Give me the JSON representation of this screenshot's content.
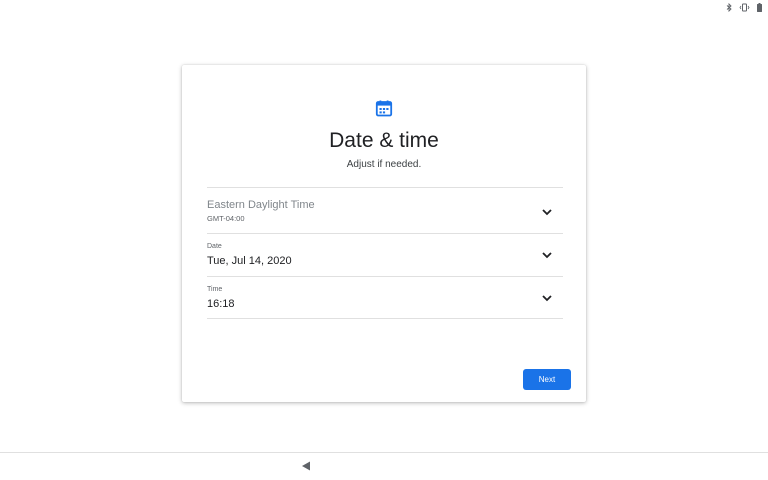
{
  "status_bar": {
    "icons": [
      "bluetooth-icon",
      "vibrate-icon",
      "battery-icon"
    ]
  },
  "card": {
    "icon": "calendar-icon",
    "title": "Date & time",
    "subtitle": "Adjust if needed."
  },
  "timezone": {
    "name": "Eastern Daylight Time",
    "offset": "GMT-04:00"
  },
  "date": {
    "label": "Date",
    "value": "Tue, Jul 14, 2020"
  },
  "time": {
    "label": "Time",
    "value": "16:18"
  },
  "actions": {
    "next_label": "Next"
  },
  "navigation": {
    "back_icon": "back-icon"
  },
  "colors": {
    "accent": "#1a73e8",
    "divider": "#e0e0e0",
    "text_primary": "#202124",
    "text_secondary": "#5f6368"
  }
}
